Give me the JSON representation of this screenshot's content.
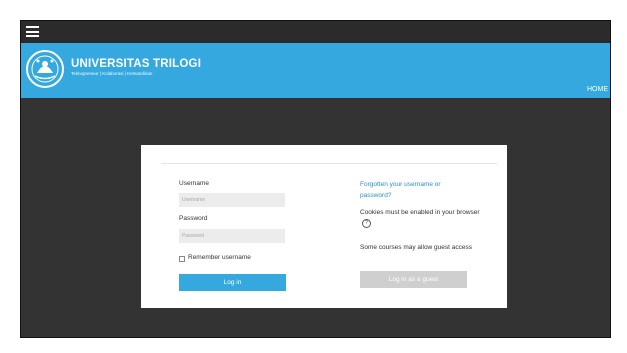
{
  "header": {
    "brand_name": "UNIVERSITAS TRILOGI",
    "tagline": "Teknopreneur | Kolaborasi | Kemandirian",
    "home_link": "HOME"
  },
  "icons": {
    "menu": "hamburger-menu-icon",
    "logo": "university-seal",
    "help": "question-circle-icon"
  },
  "colors": {
    "brand_blue": "#35a9df",
    "link_blue": "#2b8fd0",
    "dark_bg": "#333333",
    "guest_button": "#cfcfcf"
  },
  "login": {
    "username_label": "Username",
    "username_placeholder": "Username",
    "password_label": "Password",
    "password_placeholder": "Password",
    "remember_label": "Remember username",
    "login_button": "Log in",
    "forgot_link": "Forgotten your username or password?",
    "cookies_notice": "Cookies must be enabled in your browser",
    "guest_notice": "Some courses may allow guest access",
    "guest_button": "Log in as a guest"
  }
}
